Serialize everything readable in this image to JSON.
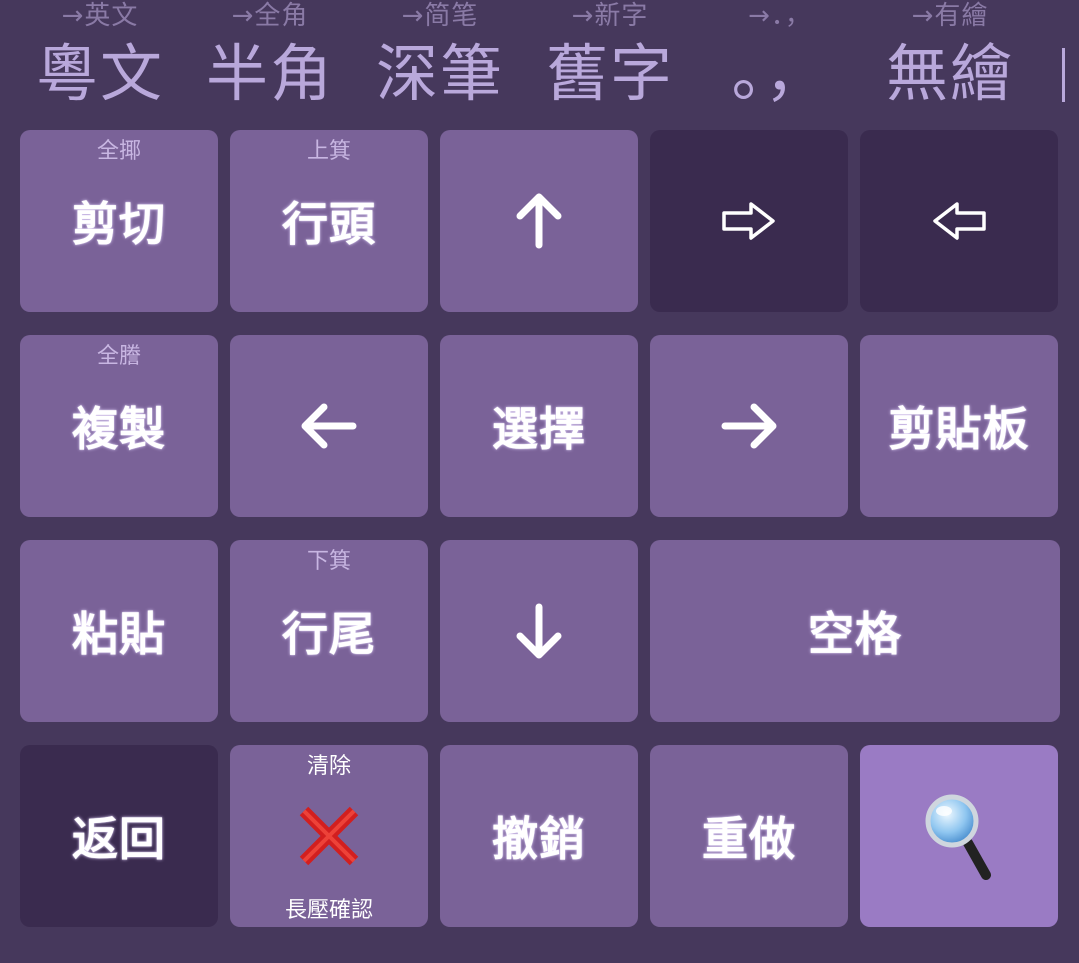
{
  "toolbar": {
    "items": [
      {
        "hint": "→英文",
        "main": "粵文"
      },
      {
        "hint": "→全角",
        "main": "半角"
      },
      {
        "hint": "→简笔",
        "main": "深筆"
      },
      {
        "hint": "→新字",
        "main": "舊字"
      },
      {
        "hint": "→．，",
        "main": "。，"
      },
      {
        "hint": "→有繪",
        "main": "無繪"
      }
    ]
  },
  "keys": {
    "cut": {
      "hint": "全揶",
      "label": "剪切"
    },
    "line_start": {
      "hint": "上箕",
      "label": "行頭"
    },
    "up": {
      "icon": "arrow-up-icon"
    },
    "forward_delete": {
      "icon": "hollow-arrow-right-icon"
    },
    "backspace": {
      "icon": "hollow-arrow-left-icon"
    },
    "copy": {
      "hint": "全謄",
      "label": "複製"
    },
    "left": {
      "icon": "arrow-left-icon"
    },
    "select": {
      "label": "選擇"
    },
    "right": {
      "icon": "arrow-right-icon"
    },
    "clipboard": {
      "label": "剪貼板"
    },
    "paste": {
      "label": "粘貼"
    },
    "line_end": {
      "hint": "下箕",
      "label": "行尾"
    },
    "down": {
      "icon": "arrow-down-icon"
    },
    "space": {
      "label": "空格"
    },
    "back": {
      "label": "返回"
    },
    "clear": {
      "hint": "清除",
      "icon": "cross-mark-icon",
      "sublabel": "長壓確認"
    },
    "undo": {
      "label": "撤銷"
    },
    "redo": {
      "label": "重做"
    },
    "search": {
      "icon": "magnifier-icon"
    }
  },
  "colors": {
    "background": "#46385c",
    "key": "#7a6298",
    "key_dark": "#3a2b4f",
    "key_accent": "#9a7bc4",
    "toolbar_text": "#b9a8db",
    "cross": "#d21f1f"
  }
}
